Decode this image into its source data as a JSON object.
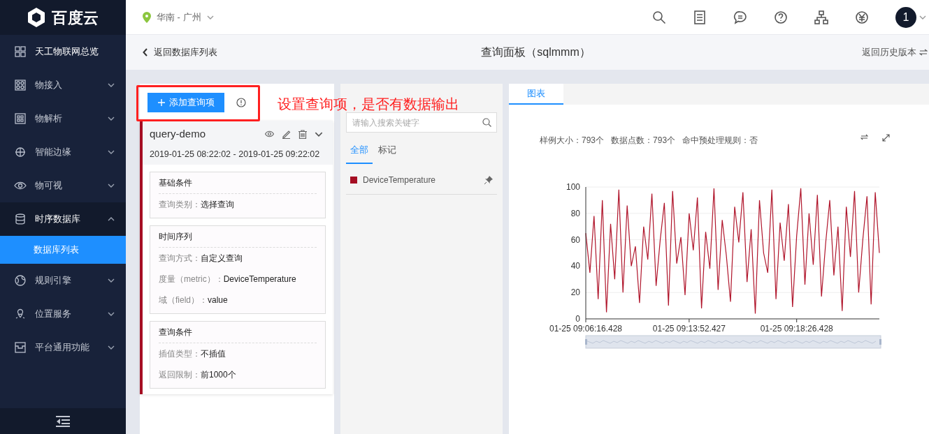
{
  "sidebar": {
    "logo": "百度云",
    "items": [
      {
        "label": "天工物联网总览",
        "kind": "link"
      },
      {
        "label": "物接入",
        "kind": "group",
        "expanded": false
      },
      {
        "label": "物解析",
        "kind": "group",
        "expanded": false
      },
      {
        "label": "智能边缘",
        "kind": "group",
        "expanded": false
      },
      {
        "label": "物可视",
        "kind": "group",
        "expanded": false
      },
      {
        "label": "时序数据库",
        "kind": "group",
        "expanded": true,
        "children": [
          {
            "label": "数据库列表",
            "selected": true
          }
        ]
      },
      {
        "label": "规则引擎",
        "kind": "group",
        "expanded": false
      },
      {
        "label": "位置服务",
        "kind": "group",
        "expanded": false
      },
      {
        "label": "平台通用功能",
        "kind": "group",
        "expanded": false
      }
    ]
  },
  "topbar": {
    "region": "华南 - 广州",
    "avatar": "1"
  },
  "subheader": {
    "back": "返回数据库列表",
    "title": "查询面板（sqlmmm）",
    "history": "返回历史版本"
  },
  "query_panel": {
    "add_button": "添加查询项",
    "query": {
      "name": "query-demo",
      "time_range": "2019-01-25 08:22:02 - 2019-01-25 09:22:02",
      "sections": [
        {
          "title": "基础条件",
          "rows": [
            {
              "label": "查询类别：",
              "value": "选择查询"
            }
          ]
        },
        {
          "title": "时间序列",
          "rows": [
            {
              "label": "查询方式：",
              "value": "自定义查询"
            },
            {
              "label": "度量（metric）：",
              "value": "DeviceTemperature"
            },
            {
              "label": "域（field）：",
              "value": "value"
            }
          ]
        },
        {
          "title": "查询条件",
          "rows": [
            {
              "label": "插值类型：",
              "value": "不插值"
            },
            {
              "label": "返回限制：",
              "value": "前1000个"
            }
          ]
        }
      ]
    }
  },
  "annotation": {
    "text": "设置查询项，是否有数据输出"
  },
  "metrics_panel": {
    "search": {
      "placeholder": "请输入搜索关键字"
    },
    "tabs": [
      {
        "label": "全部",
        "selected": true
      },
      {
        "label": "标记",
        "selected": false
      }
    ],
    "metrics": [
      {
        "name": "DeviceTemperature",
        "color": "#a50e23"
      }
    ]
  },
  "chart_panel": {
    "tabs": [
      {
        "label": "图表",
        "selected": true
      }
    ],
    "stats": [
      "样例大小：793个",
      "数据点数：793个",
      "命中预处理规则：否"
    ],
    "chart_data": {
      "type": "line",
      "grid": true,
      "categories": [
        "01-25 09:06:16.428",
        null,
        null,
        null,
        null,
        null,
        null,
        null,
        null,
        null,
        null,
        null,
        null,
        null,
        null,
        null,
        null,
        null,
        null,
        null,
        null,
        null,
        null,
        null,
        null,
        "01-25 09:13:52.427",
        null,
        null,
        null,
        null,
        null,
        null,
        null,
        null,
        null,
        null,
        null,
        null,
        null,
        null,
        null,
        null,
        null,
        null,
        null,
        null,
        null,
        null,
        null,
        null,
        null,
        "01-25 09:18:26.428",
        null,
        null,
        null,
        null,
        null,
        null,
        null,
        null,
        null,
        null,
        null,
        null,
        null,
        null,
        null,
        null,
        null,
        null,
        null,
        null
      ],
      "ylim": [
        0,
        100
      ],
      "yticks": [
        0,
        20,
        40,
        60,
        80,
        100
      ],
      "series": [
        {
          "color": "#b0152b",
          "values": [
            65,
            35,
            78,
            15,
            90,
            5,
            72,
            30,
            98,
            20,
            86,
            40,
            55,
            12,
            70,
            45,
            95,
            25,
            60,
            88,
            10,
            97,
            42,
            62,
            18,
            80,
            52,
            92,
            8,
            66,
            38,
            99,
            22,
            75,
            48,
            13,
            85,
            58,
            96,
            28,
            68,
            4,
            90,
            50,
            35,
            98,
            15,
            73,
            44,
            87,
            9,
            63,
            99,
            26,
            80,
            41,
            94,
            17,
            57,
            90,
            33,
            70,
            6,
            85,
            47,
            97,
            20,
            60,
            93,
            11,
            96,
            50
          ]
        }
      ]
    }
  }
}
